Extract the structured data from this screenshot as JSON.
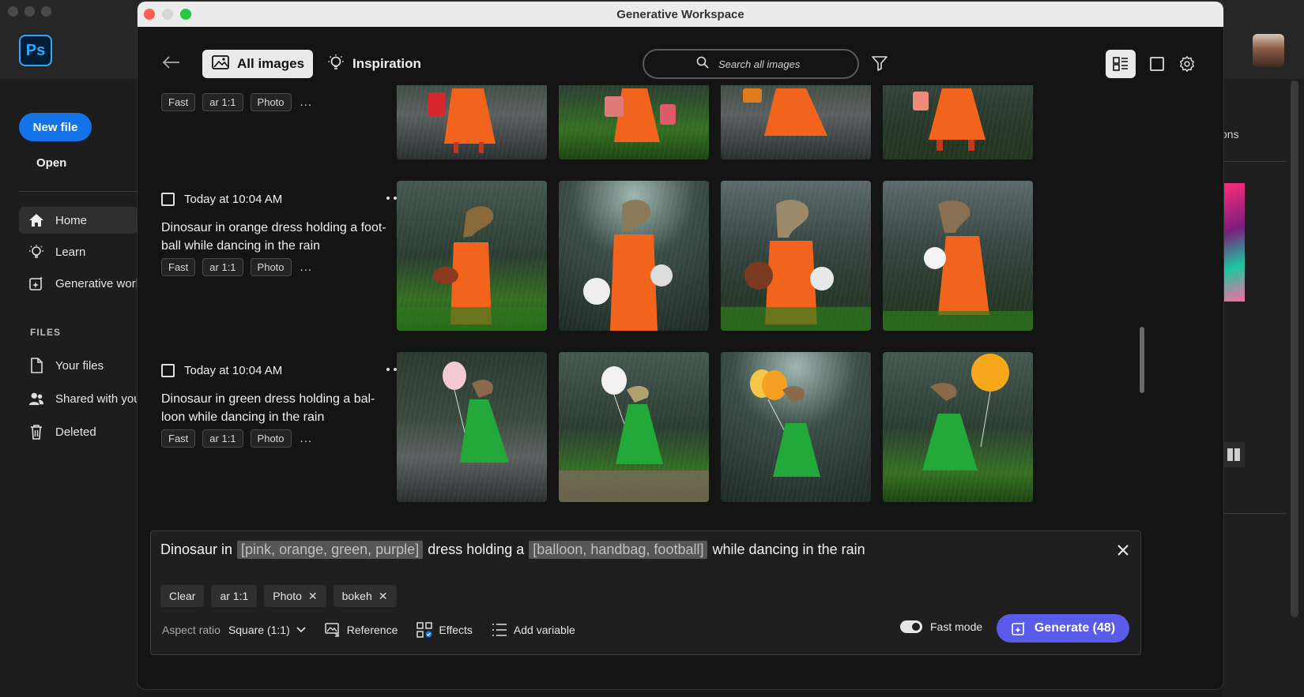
{
  "background_app": {
    "logo": "Ps",
    "new_file": "New file",
    "open": "Open",
    "nav": [
      {
        "label": "Home",
        "icon": "home-icon"
      },
      {
        "label": "Learn",
        "icon": "lightbulb-icon"
      },
      {
        "label": "Generative worl",
        "icon": "generative-icon"
      }
    ],
    "files_heading": "FILES",
    "files": [
      {
        "label": "Your files",
        "icon": "file-icon"
      },
      {
        "label": "Shared with you",
        "icon": "people-icon"
      },
      {
        "label": "Deleted",
        "icon": "trash-icon"
      }
    ],
    "right_partial": "ons"
  },
  "window": {
    "title": "Generative Workspace"
  },
  "toolbar": {
    "all_images": "All images",
    "inspiration": "Inspiration",
    "search_placeholder": "Search all images"
  },
  "groups": [
    {
      "time": "",
      "prompt": "",
      "tags": [
        "Fast",
        "ar 1:1",
        "Photo"
      ],
      "more": "...",
      "images": [
        {
          "desc": "dinosaur in orange dress with red handbag",
          "dress": "#f2641b",
          "accent": "#d8262e"
        },
        {
          "desc": "dinosaur in orange dress with two handbags",
          "dress": "#f2641b",
          "accent": "#e05a6a"
        },
        {
          "desc": "dinosaur in orange dress dancing in rain",
          "dress": "#f2641b",
          "accent": "#e07b1b"
        },
        {
          "desc": "dinosaur in orange dress with pink handbag",
          "dress": "#f2641b",
          "accent": "#f08a7a"
        }
      ]
    },
    {
      "time": "Today at 10:04 AM",
      "prompt": "Dinosaur in orange dress holding a foot-ball while dancing in the rain",
      "tags": [
        "Fast",
        "ar 1:1",
        "Photo"
      ],
      "more": "...",
      "images": [
        {
          "desc": "dinosaur in orange dress holding american football",
          "dress": "#f2641b",
          "accent": "#8a3a1e"
        },
        {
          "desc": "dinosaur in orange dress holding soccer balls",
          "dress": "#f2641b",
          "accent": "#eeeeee"
        },
        {
          "desc": "dinosaur in orange dress holding basketball",
          "dress": "#f2641b",
          "accent": "#7a3a20"
        },
        {
          "desc": "dinosaur in orange dress kicking soccer ball",
          "dress": "#f2641b",
          "accent": "#f5f5f5"
        }
      ]
    },
    {
      "time": "Today at 10:04 AM",
      "prompt": "Dinosaur in green dress holding a bal-loon while dancing in the rain",
      "tags": [
        "Fast",
        "ar 1:1",
        "Photo"
      ],
      "more": "...",
      "images": [
        {
          "desc": "dinosaur in green dress with pink balloon",
          "dress": "#23a83a",
          "accent": "#f4c9d6"
        },
        {
          "desc": "dinosaur in green dress with white balloon",
          "dress": "#23a83a",
          "accent": "#f2f2f2"
        },
        {
          "desc": "dinosaur in green dress with orange balloons",
          "dress": "#23a83a",
          "accent": "#f4a021"
        },
        {
          "desc": "dinosaur in green dress with yellow balloon",
          "dress": "#23a83a",
          "accent": "#f6a81c"
        }
      ]
    }
  ],
  "prompt_panel": {
    "prefix": "Dinosaur in",
    "var1": "[pink, orange, green, purple]",
    "middle": "dress holding a",
    "var2": "[balloon, handbag, football]",
    "suffix": "while dancing in the rain",
    "clear": "Clear",
    "chips": [
      {
        "label": "ar 1:1",
        "removable": false
      },
      {
        "label": "Photo",
        "removable": true
      },
      {
        "label": "bokeh",
        "removable": true
      }
    ],
    "aspect_ratio_label": "Aspect ratio",
    "aspect_ratio_value": "Square (1:1)",
    "reference": "Reference",
    "effects": "Effects",
    "add_variable": "Add variable",
    "fast_mode": "Fast mode",
    "generate": "Generate (48)"
  },
  "colors": {
    "accent_blue": "#1473e6",
    "generate_purple": "#5b5bea",
    "modal_bg": "#141414"
  }
}
